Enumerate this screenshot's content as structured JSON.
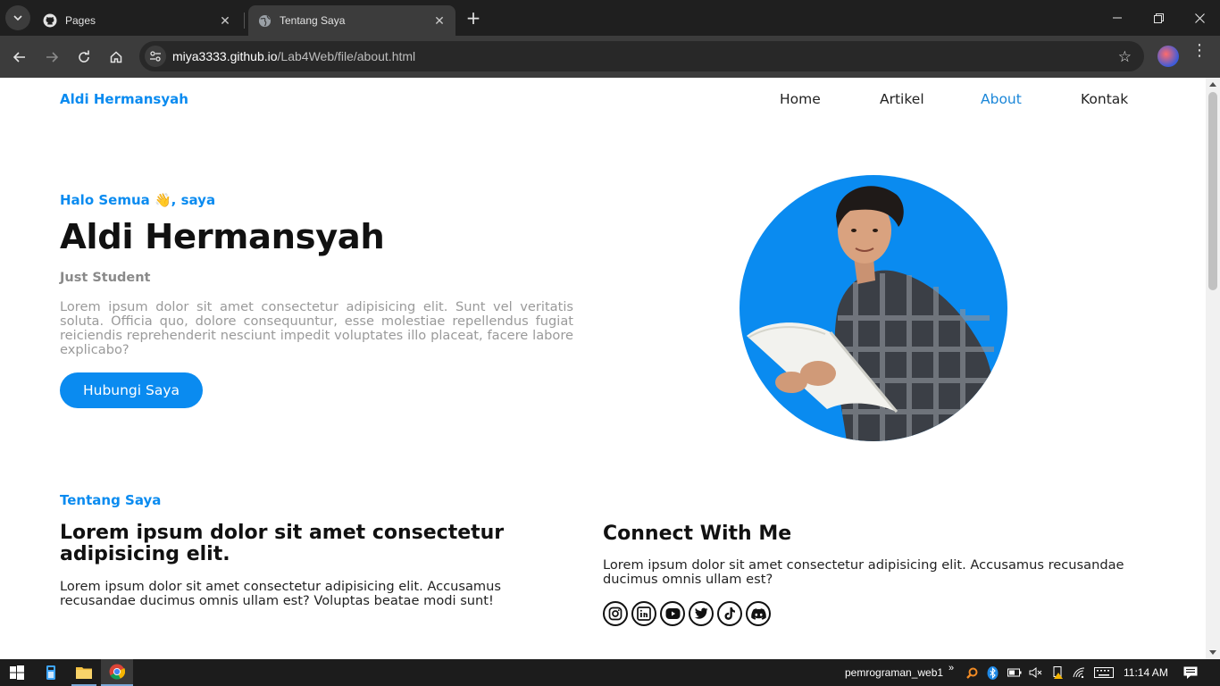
{
  "browser": {
    "tabs": [
      {
        "title": "Pages",
        "favicon": "github-icon",
        "active": false
      },
      {
        "title": "Tentang Saya",
        "favicon": "globe-icon",
        "active": true
      }
    ],
    "url_host": "miya3333.github.io",
    "url_path": "/Lab4Web/file/about.html"
  },
  "site": {
    "brand": "Aldi Hermansyah",
    "nav": [
      {
        "label": "Home"
      },
      {
        "label": "Artikel"
      },
      {
        "label": "About",
        "active": true
      },
      {
        "label": "Kontak"
      }
    ]
  },
  "hero": {
    "greeting": "Halo Semua 👋, saya",
    "name": "Aldi Hermansyah",
    "role": "Just Student",
    "description": "Lorem ipsum dolor sit amet consectetur adipisicing elit. Sunt vel veritatis soluta. Officia quo, dolore consequuntur, esse molestiae repellendus fugiat reiciendis reprehenderit nesciunt impedit voluptates illo placeat, facere labore explicabo?",
    "cta": "Hubungi Saya"
  },
  "about": {
    "label": "Tentang Saya",
    "title": "Lorem ipsum dolor sit amet consectetur adipisicing elit.",
    "description": "Lorem ipsum dolor sit amet consectetur adipisicing elit. Accusamus recusandae ducimus omnis ullam est? Voluptas beatae modi sunt!"
  },
  "connect": {
    "title": "Connect With Me",
    "description": "Lorem ipsum dolor sit amet consectetur adipisicing elit. Accusamus recusandae ducimus omnis ullam est?",
    "socials": [
      "instagram-icon",
      "linkedin-icon",
      "youtube-icon",
      "twitter-icon",
      "tiktok-icon",
      "discord-icon"
    ]
  },
  "taskbar": {
    "label": "pemrograman_web1",
    "time": "11:14 AM"
  },
  "colors": {
    "accent": "#0a8bf0",
    "nav_active": "#1a86d8"
  }
}
